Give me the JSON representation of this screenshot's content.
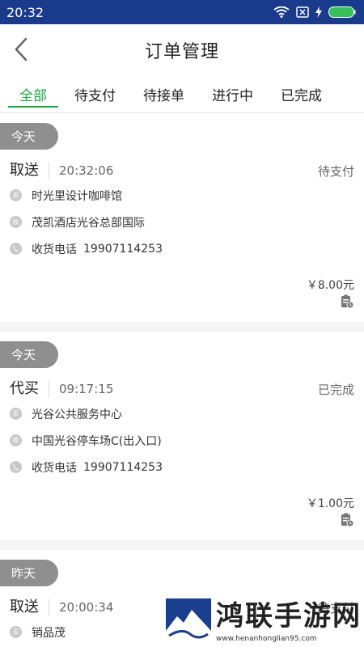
{
  "statusbar": {
    "time": "20:32"
  },
  "header": {
    "title": "订单管理"
  },
  "tabs": [
    {
      "label": "全部",
      "active": true
    },
    {
      "label": "待支付",
      "active": false
    },
    {
      "label": "待接单",
      "active": false
    },
    {
      "label": "进行中",
      "active": false
    },
    {
      "label": "已完成",
      "active": false
    }
  ],
  "orders": [
    {
      "day": "今天",
      "type": "取送",
      "time": "20:32:06",
      "status": "待支付",
      "from": "时光里设计咖啡馆",
      "to": "茂凯酒店光谷总部国际",
      "phone_label": "收货电话",
      "phone": "19907114253",
      "price": "￥8.00元"
    },
    {
      "day": "今天",
      "type": "代买",
      "time": "09:17:15",
      "status": "已完成",
      "from": "光谷公共服务中心",
      "to": "中国光谷停车场C(出入口)",
      "phone_label": "收货电话",
      "phone": "19907114253",
      "price": "￥1.00元"
    },
    {
      "day": "昨天",
      "type": "取送",
      "time": "20:00:34",
      "status": "待支付",
      "from": "销品茂"
    }
  ],
  "icon_labels": {
    "from": "买",
    "to": "收"
  },
  "watermark": {
    "name": "鸿联手游网",
    "url": "www.henanhonglian95.com"
  },
  "colors": {
    "statusbar": "#1a3a8c",
    "accent": "#1fa244",
    "pill": "#8f8f8f"
  }
}
